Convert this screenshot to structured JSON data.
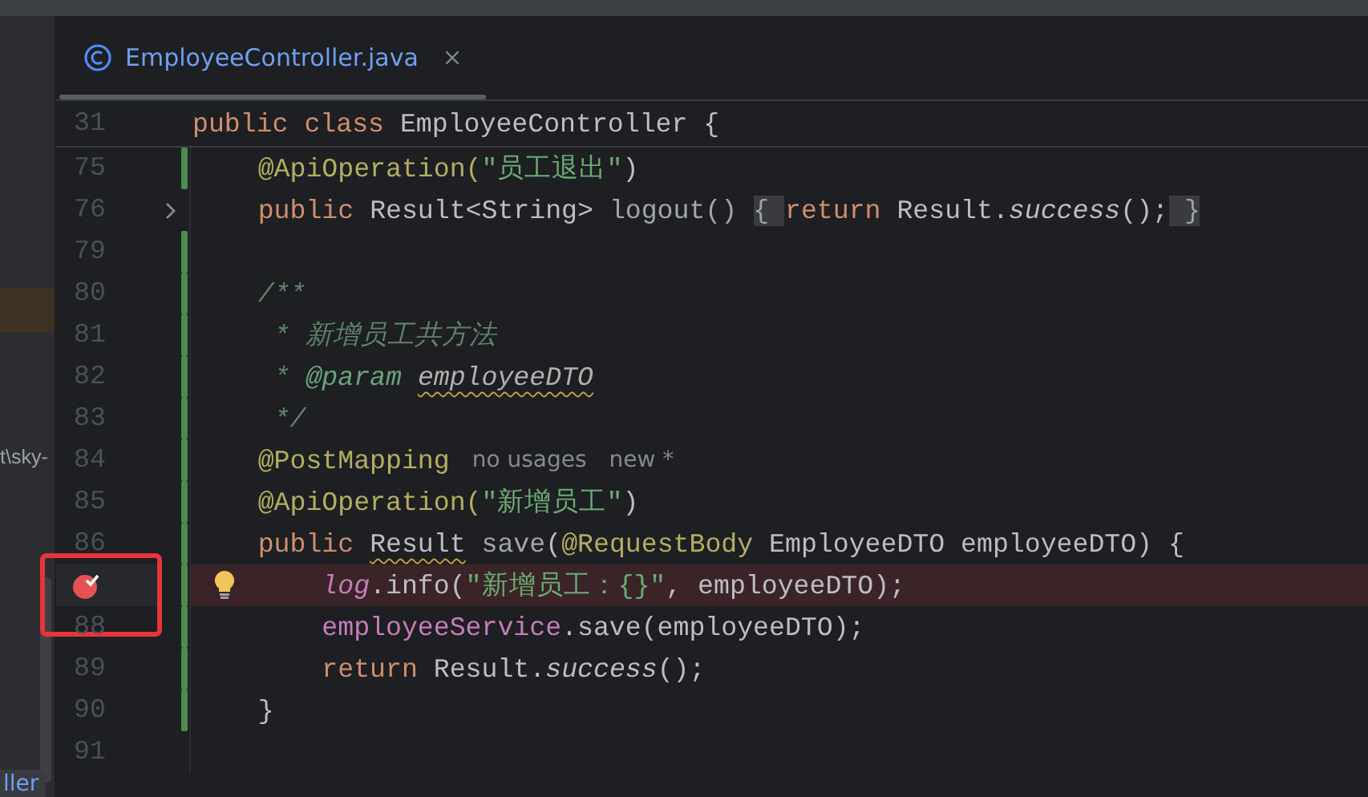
{
  "sidebar": {
    "texts": [
      {
        "text": "t\\sky-",
        "kind": "path"
      },
      {
        "text": "ller",
        "kind": "tooltip"
      }
    ]
  },
  "tab": {
    "title": "EmployeeController.java",
    "selected": true
  },
  "sticky_line": {
    "number": "31",
    "tokens": [
      {
        "text": "public class ",
        "kind": "kw"
      },
      {
        "text": "EmployeeController ",
        "kind": "plain"
      },
      {
        "text": "{",
        "kind": "plain"
      }
    ]
  },
  "lines": [
    {
      "number": "75",
      "modified": true,
      "folded": false,
      "tokens": [
        {
          "text": "    @ApiOperation(",
          "kind": "ann"
        },
        {
          "text": "\"员工退出\"",
          "kind": "str"
        },
        {
          "text": ")",
          "kind": "plain"
        }
      ]
    },
    {
      "number": "76",
      "modified": false,
      "folded": true,
      "tokens": [
        {
          "text": "    public ",
          "kind": "kw"
        },
        {
          "text": "Result<String> ",
          "kind": "plain"
        },
        {
          "text": "logout() ",
          "kind": "dim"
        },
        {
          "text": "{ ",
          "kind": "fold"
        },
        {
          "text": "return ",
          "kind": "kw"
        },
        {
          "text": "Result.",
          "kind": "plain"
        },
        {
          "text": "success",
          "kind": "italic"
        },
        {
          "text": "();",
          "kind": "plain"
        },
        {
          "text": " }",
          "kind": "fold"
        }
      ]
    },
    {
      "number": "79",
      "modified": true,
      "folded": false
    },
    {
      "number": "80",
      "modified": true,
      "folded": false,
      "tokens": [
        {
          "text": "    /**",
          "kind": "doc"
        }
      ]
    },
    {
      "number": "81",
      "modified": true,
      "folded": false,
      "tokens": [
        {
          "text": "     * 新增员工共方法",
          "kind": "doc"
        }
      ]
    },
    {
      "number": "82",
      "modified": true,
      "folded": false,
      "tokens": [
        {
          "text": "     * ",
          "kind": "doc"
        },
        {
          "text": "@param ",
          "kind": "doctag"
        },
        {
          "text": "employeeDTO",
          "kind": "docparam"
        }
      ]
    },
    {
      "number": "83",
      "modified": true,
      "folded": false,
      "tokens": [
        {
          "text": "     */",
          "kind": "doc"
        }
      ]
    },
    {
      "number": "84",
      "modified": true,
      "folded": false,
      "tokens": [
        {
          "text": "    @PostMapping",
          "kind": "ann"
        }
      ],
      "hints": [
        "no usages",
        "new *"
      ]
    },
    {
      "number": "85",
      "modified": true,
      "folded": false,
      "tokens": [
        {
          "text": "    @ApiOperation(",
          "kind": "ann"
        },
        {
          "text": "\"新增员工\"",
          "kind": "str"
        },
        {
          "text": ")",
          "kind": "plain"
        }
      ]
    },
    {
      "number": "86",
      "modified": true,
      "folded": false,
      "tokens": [
        {
          "text": "    public ",
          "kind": "kw"
        },
        {
          "text": "Result",
          "kind": "warn"
        },
        {
          "text": " save",
          "kind": "dim"
        },
        {
          "text": "(",
          "kind": "plain"
        },
        {
          "text": "@RequestBody ",
          "kind": "ann"
        },
        {
          "text": "EmployeeDTO employeeDTO) {",
          "kind": "plain"
        }
      ]
    },
    {
      "modified": true,
      "folded": false,
      "breakpoint": true,
      "highlighted": true,
      "intention": true,
      "tokens": [
        {
          "text": "        log",
          "kind": "field"
        },
        {
          "text": ".info(",
          "kind": "plain"
        },
        {
          "text": "\"新增员工：{}\"",
          "kind": "str"
        },
        {
          "text": ", employeeDTO);",
          "kind": "plain"
        }
      ]
    },
    {
      "number": "88",
      "modified": true,
      "folded": false,
      "tokens": [
        {
          "text": "        employeeService",
          "kind": "member"
        },
        {
          "text": ".save(employeeDTO);",
          "kind": "plain"
        }
      ]
    },
    {
      "number": "89",
      "modified": true,
      "folded": false,
      "tokens": [
        {
          "text": "        return ",
          "kind": "kw"
        },
        {
          "text": "Result.",
          "kind": "plain"
        },
        {
          "text": "success",
          "kind": "italic"
        },
        {
          "text": "();",
          "kind": "plain"
        }
      ]
    },
    {
      "number": "90",
      "modified": true,
      "folded": false,
      "tokens": [
        {
          "text": "    }",
          "kind": "plain"
        }
      ]
    },
    {
      "number": "91",
      "modified": false,
      "folded": false
    }
  ]
}
